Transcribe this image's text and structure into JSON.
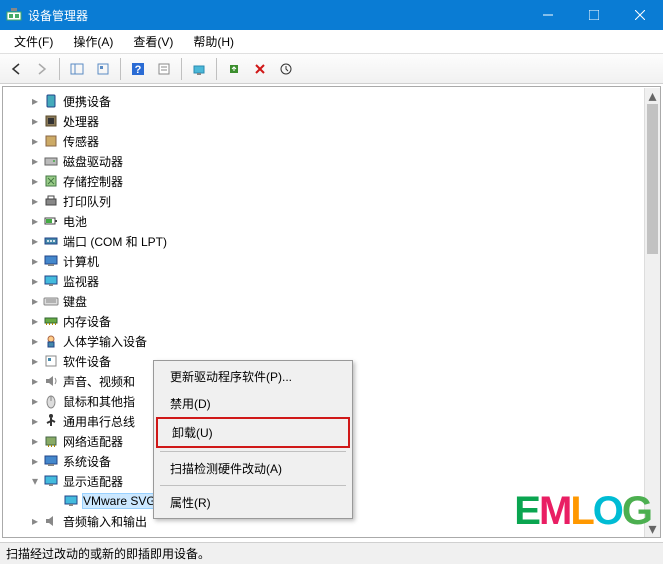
{
  "window": {
    "title": "设备管理器"
  },
  "menus": {
    "file": "文件(F)",
    "action": "操作(A)",
    "view": "查看(V)",
    "help": "帮助(H)"
  },
  "categories": [
    {
      "name": "便携设备",
      "icon": "portable"
    },
    {
      "name": "处理器",
      "icon": "cpu"
    },
    {
      "name": "传感器",
      "icon": "sensor"
    },
    {
      "name": "磁盘驱动器",
      "icon": "disk"
    },
    {
      "name": "存储控制器",
      "icon": "storage"
    },
    {
      "name": "打印队列",
      "icon": "printer"
    },
    {
      "name": "电池",
      "icon": "battery"
    },
    {
      "name": "端口 (COM 和 LPT)",
      "icon": "port"
    },
    {
      "name": "计算机",
      "icon": "computer"
    },
    {
      "name": "监视器",
      "icon": "monitor"
    },
    {
      "name": "键盘",
      "icon": "keyboard"
    },
    {
      "name": "内存设备",
      "icon": "memory"
    },
    {
      "name": "人体学输入设备",
      "icon": "hid"
    },
    {
      "name": "软件设备",
      "icon": "software"
    },
    {
      "name": "声音、视频和",
      "icon": "sound"
    },
    {
      "name": "鼠标和其他指",
      "icon": "mouse"
    },
    {
      "name": "通用串行总线",
      "icon": "usb"
    },
    {
      "name": "网络适配器",
      "icon": "network"
    },
    {
      "name": "系统设备",
      "icon": "system"
    },
    {
      "name": "显示适配器",
      "icon": "display",
      "expanded": true
    },
    {
      "name": "音频输入和输出",
      "icon": "audio"
    }
  ],
  "display_child": "VMware SVGA 3D",
  "context_menu": {
    "update": "更新驱动程序软件(P)...",
    "disable": "禁用(D)",
    "uninstall": "卸载(U)",
    "scan": "扫描检测硬件改动(A)",
    "properties": "属性(R)"
  },
  "statusbar": "扫描经过改动的或新的即插即用设备。",
  "watermark": "EMLOG"
}
